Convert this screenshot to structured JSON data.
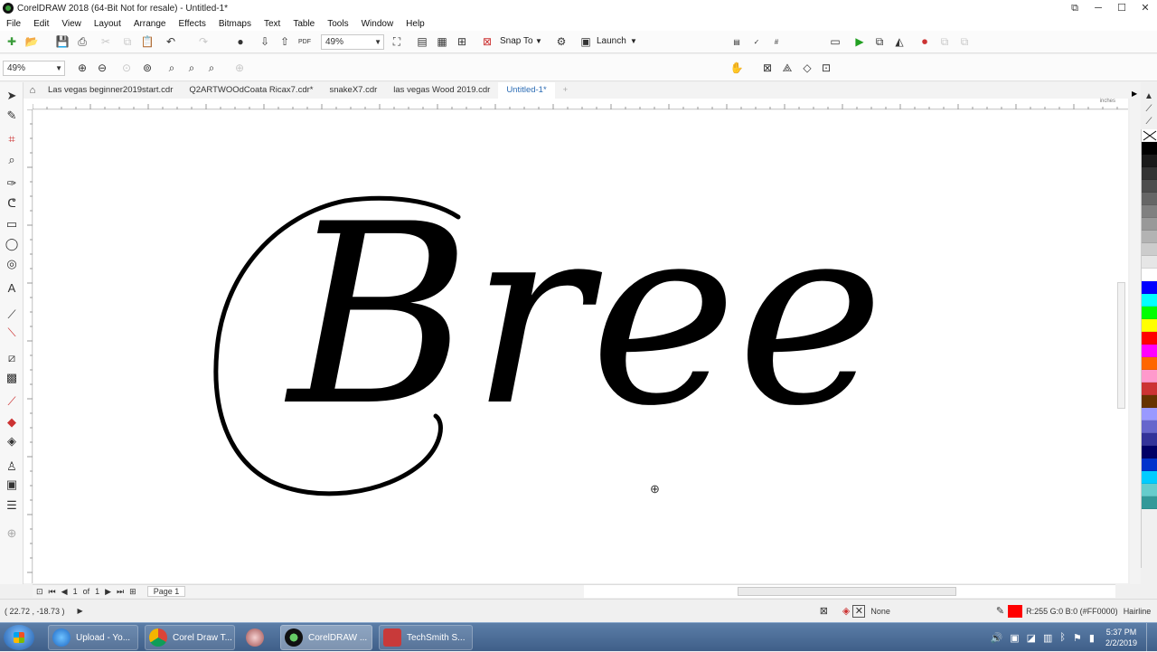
{
  "app": {
    "title": "CorelDRAW 2018 (64-Bit Not for resale) - Untitled-1*"
  },
  "menu": [
    "File",
    "Edit",
    "View",
    "Layout",
    "Arrange",
    "Effects",
    "Bitmaps",
    "Text",
    "Table",
    "Tools",
    "Window",
    "Help"
  ],
  "toolbar": {
    "zoom_value": "49%",
    "snap_label": "Snap To",
    "launch_label": "Launch",
    "pdf_label": "PDF"
  },
  "propertybar": {
    "zoom_value": "49%"
  },
  "tabs": [
    "Las vegas beginner2019start.cdr",
    "Q2ARTWOOdCoata Ricax7.cdr*",
    "snakeX7.cdr",
    "las vegas Wood 2019.cdr",
    "Untitled-1*"
  ],
  "canvas": {
    "text": "Bree"
  },
  "ruler": {
    "units": "inches"
  },
  "page_nav": {
    "current": "1",
    "of_label": "of",
    "total": "1",
    "page_tab": "Page 1"
  },
  "status": {
    "coords": "( 22.72 , -18.73 )",
    "fill_none": "None",
    "outline_color": "R:255 G:0 B:0 (#FF0000)",
    "outline_width": "Hairline"
  },
  "colors": {
    "accent": "#2d6db5",
    "outline_swatch": "#ff0000"
  },
  "palette": [
    "#000000",
    "#1a1a1a",
    "#333333",
    "#4d4d4d",
    "#666666",
    "#808080",
    "#999999",
    "#b3b3b3",
    "#cccccc",
    "#e6e6e6",
    "#ffffff",
    "#0000ff",
    "#00ffff",
    "#00ff00",
    "#ffff00",
    "#ff0000",
    "#ff00ff",
    "#ff6600",
    "#ff99cc",
    "#cc3333",
    "#663300",
    "#9999ff",
    "#6666cc",
    "#333399",
    "#000066",
    "#0033cc",
    "#00ccff",
    "#66cccc",
    "#339999"
  ],
  "taskbar": {
    "items": [
      {
        "label": "Upload - Yo..."
      },
      {
        "label": "Corel Draw T..."
      },
      {
        "label": "CorelDRAW ..."
      },
      {
        "label": "TechSmith S..."
      }
    ],
    "time": "5:37 PM",
    "date": "2/2/2019"
  }
}
